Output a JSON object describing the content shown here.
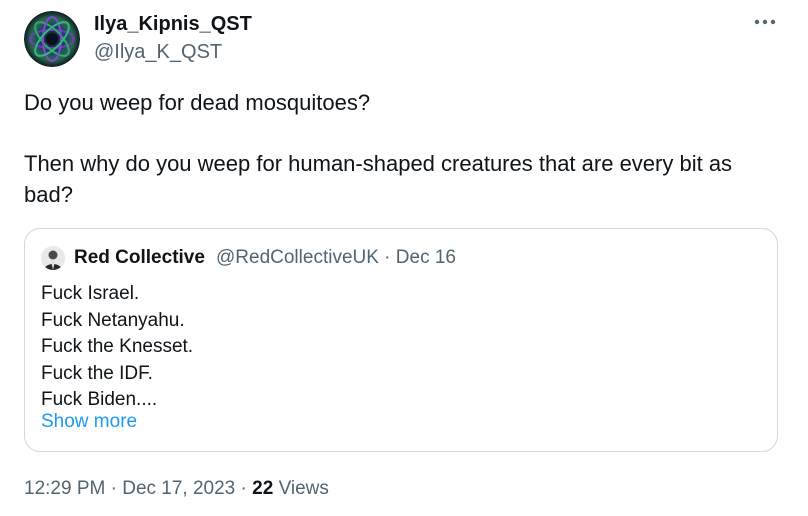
{
  "author": {
    "name": "Ilya_Kipnis_QST",
    "handle": "@Ilya_K_QST"
  },
  "tweet": {
    "paragraph_1": "Do you weep for dead mosquitoes?",
    "paragraph_2": "Then why do you weep for human-shaped creatures that are every bit as bad?"
  },
  "quoted_tweet": {
    "name": "Red Collective",
    "handle": "@RedCollectiveUK",
    "date": "Dec 16",
    "lines": [
      "Fuck Israel.",
      "Fuck Netanyahu.",
      "Fuck the Knesset.",
      "Fuck the IDF.",
      "Fuck Biden...."
    ],
    "show_more": "Show more"
  },
  "meta": {
    "time": "12:29 PM",
    "date": "Dec 17, 2023",
    "views_count": "22",
    "views_label": "Views"
  },
  "icons": {
    "more": "more-horizontal-icon"
  },
  "colors": {
    "text_primary": "#0f1419",
    "text_secondary": "#536471",
    "link": "#1d9bf0",
    "border": "#cfd9de"
  }
}
